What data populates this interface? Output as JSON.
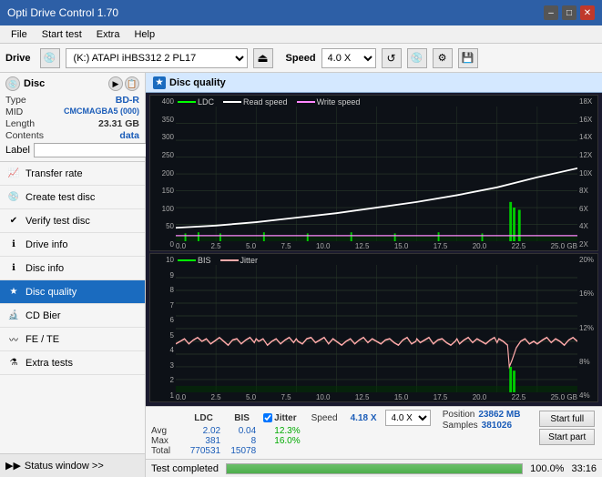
{
  "titlebar": {
    "title": "Opti Drive Control 1.70",
    "min_label": "–",
    "max_label": "□",
    "close_label": "✕"
  },
  "menubar": {
    "items": [
      "File",
      "Start test",
      "Extra",
      "Help"
    ]
  },
  "drivebar": {
    "label": "Drive",
    "drive_value": "(K:) ATAPI iHBS312  2 PL17",
    "speed_label": "Speed",
    "speed_value": "4.0 X"
  },
  "disc": {
    "header_label": "Disc",
    "type_label": "Type",
    "type_value": "BD-R",
    "mid_label": "MID",
    "mid_value": "CMCMAGBA5 (000)",
    "length_label": "Length",
    "length_value": "23.31 GB",
    "contents_label": "Contents",
    "contents_value": "data",
    "label_label": "Label",
    "label_value": ""
  },
  "nav": {
    "items": [
      {
        "id": "transfer-rate",
        "label": "Transfer rate",
        "active": false
      },
      {
        "id": "create-test-disc",
        "label": "Create test disc",
        "active": false
      },
      {
        "id": "verify-test-disc",
        "label": "Verify test disc",
        "active": false
      },
      {
        "id": "drive-info",
        "label": "Drive info",
        "active": false
      },
      {
        "id": "disc-info",
        "label": "Disc info",
        "active": false
      },
      {
        "id": "disc-quality",
        "label": "Disc quality",
        "active": true
      },
      {
        "id": "cd-bier",
        "label": "CD Bier",
        "active": false
      },
      {
        "id": "fe-te",
        "label": "FE / TE",
        "active": false
      },
      {
        "id": "extra-tests",
        "label": "Extra tests",
        "active": false
      }
    ]
  },
  "sidebar_status": {
    "label": "Status window >>"
  },
  "disc_quality": {
    "title": "Disc quality",
    "legend": {
      "ldc": {
        "label": "LDC",
        "color": "#00ff00"
      },
      "read_speed": {
        "label": "Read speed",
        "color": "#ffffff"
      },
      "write_speed": {
        "label": "Write speed",
        "color": "#ff88ff"
      }
    },
    "legend2": {
      "bis": {
        "label": "BIS",
        "color": "#00ff00"
      },
      "jitter": {
        "label": "Jitter",
        "color": "#ffaaaa"
      }
    },
    "chart1": {
      "y_labels": [
        "400",
        "350",
        "300",
        "250",
        "200",
        "150",
        "100",
        "50",
        "0"
      ],
      "y_labels_right": [
        "18X",
        "16X",
        "14X",
        "12X",
        "10X",
        "8X",
        "6X",
        "4X",
        "2X"
      ],
      "x_labels": [
        "0.0",
        "2.5",
        "5.0",
        "7.5",
        "10.0",
        "12.5",
        "15.0",
        "17.5",
        "20.0",
        "22.5",
        "25.0 GB"
      ]
    },
    "chart2": {
      "y_labels": [
        "10",
        "9",
        "8",
        "7",
        "6",
        "5",
        "4",
        "3",
        "2",
        "1"
      ],
      "y_labels_right": [
        "20%",
        "16%",
        "12%",
        "8%",
        "4%"
      ],
      "x_labels": [
        "0.0",
        "2.5",
        "5.0",
        "7.5",
        "10.0",
        "12.5",
        "15.0",
        "17.5",
        "20.0",
        "22.5",
        "25.0 GB"
      ]
    }
  },
  "stats": {
    "ldc_header": "LDC",
    "bis_header": "BIS",
    "jitter_header": "Jitter",
    "jitter_checked": true,
    "speed_label": "Speed",
    "speed_value": "4.18 X",
    "speed_select": "4.0 X",
    "avg_label": "Avg",
    "avg_ldc": "2.02",
    "avg_bis": "0.04",
    "avg_jitter": "12.3%",
    "max_label": "Max",
    "max_ldc": "381",
    "max_bis": "8",
    "max_jitter": "16.0%",
    "total_label": "Total",
    "total_ldc": "770531",
    "total_bis": "15078",
    "position_label": "Position",
    "position_value": "23862 MB",
    "samples_label": "Samples",
    "samples_value": "381026",
    "start_full_label": "Start full",
    "start_part_label": "Start part"
  },
  "statusbar": {
    "status_text": "Test completed",
    "progress_pct": 100,
    "progress_label": "100.0%",
    "time_label": "33:16"
  }
}
